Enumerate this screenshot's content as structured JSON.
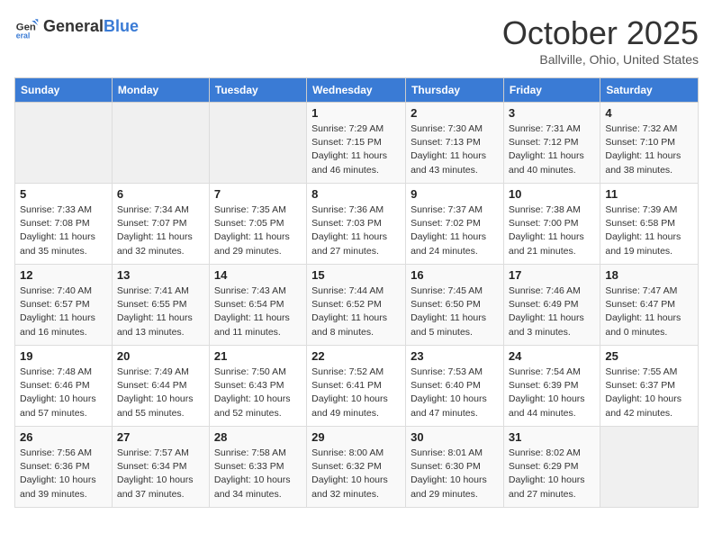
{
  "logo": {
    "general": "General",
    "blue": "Blue"
  },
  "header": {
    "month": "October 2025",
    "location": "Ballville, Ohio, United States"
  },
  "weekdays": [
    "Sunday",
    "Monday",
    "Tuesday",
    "Wednesday",
    "Thursday",
    "Friday",
    "Saturday"
  ],
  "weeks": [
    [
      null,
      null,
      null,
      {
        "day": 1,
        "sunrise": "7:29 AM",
        "sunset": "7:15 PM",
        "daylight": "11 hours and 46 minutes."
      },
      {
        "day": 2,
        "sunrise": "7:30 AM",
        "sunset": "7:13 PM",
        "daylight": "11 hours and 43 minutes."
      },
      {
        "day": 3,
        "sunrise": "7:31 AM",
        "sunset": "7:12 PM",
        "daylight": "11 hours and 40 minutes."
      },
      {
        "day": 4,
        "sunrise": "7:32 AM",
        "sunset": "7:10 PM",
        "daylight": "11 hours and 38 minutes."
      }
    ],
    [
      {
        "day": 5,
        "sunrise": "7:33 AM",
        "sunset": "7:08 PM",
        "daylight": "11 hours and 35 minutes."
      },
      {
        "day": 6,
        "sunrise": "7:34 AM",
        "sunset": "7:07 PM",
        "daylight": "11 hours and 32 minutes."
      },
      {
        "day": 7,
        "sunrise": "7:35 AM",
        "sunset": "7:05 PM",
        "daylight": "11 hours and 29 minutes."
      },
      {
        "day": 8,
        "sunrise": "7:36 AM",
        "sunset": "7:03 PM",
        "daylight": "11 hours and 27 minutes."
      },
      {
        "day": 9,
        "sunrise": "7:37 AM",
        "sunset": "7:02 PM",
        "daylight": "11 hours and 24 minutes."
      },
      {
        "day": 10,
        "sunrise": "7:38 AM",
        "sunset": "7:00 PM",
        "daylight": "11 hours and 21 minutes."
      },
      {
        "day": 11,
        "sunrise": "7:39 AM",
        "sunset": "6:58 PM",
        "daylight": "11 hours and 19 minutes."
      }
    ],
    [
      {
        "day": 12,
        "sunrise": "7:40 AM",
        "sunset": "6:57 PM",
        "daylight": "11 hours and 16 minutes."
      },
      {
        "day": 13,
        "sunrise": "7:41 AM",
        "sunset": "6:55 PM",
        "daylight": "11 hours and 13 minutes."
      },
      {
        "day": 14,
        "sunrise": "7:43 AM",
        "sunset": "6:54 PM",
        "daylight": "11 hours and 11 minutes."
      },
      {
        "day": 15,
        "sunrise": "7:44 AM",
        "sunset": "6:52 PM",
        "daylight": "11 hours and 8 minutes."
      },
      {
        "day": 16,
        "sunrise": "7:45 AM",
        "sunset": "6:50 PM",
        "daylight": "11 hours and 5 minutes."
      },
      {
        "day": 17,
        "sunrise": "7:46 AM",
        "sunset": "6:49 PM",
        "daylight": "11 hours and 3 minutes."
      },
      {
        "day": 18,
        "sunrise": "7:47 AM",
        "sunset": "6:47 PM",
        "daylight": "11 hours and 0 minutes."
      }
    ],
    [
      {
        "day": 19,
        "sunrise": "7:48 AM",
        "sunset": "6:46 PM",
        "daylight": "10 hours and 57 minutes."
      },
      {
        "day": 20,
        "sunrise": "7:49 AM",
        "sunset": "6:44 PM",
        "daylight": "10 hours and 55 minutes."
      },
      {
        "day": 21,
        "sunrise": "7:50 AM",
        "sunset": "6:43 PM",
        "daylight": "10 hours and 52 minutes."
      },
      {
        "day": 22,
        "sunrise": "7:52 AM",
        "sunset": "6:41 PM",
        "daylight": "10 hours and 49 minutes."
      },
      {
        "day": 23,
        "sunrise": "7:53 AM",
        "sunset": "6:40 PM",
        "daylight": "10 hours and 47 minutes."
      },
      {
        "day": 24,
        "sunrise": "7:54 AM",
        "sunset": "6:39 PM",
        "daylight": "10 hours and 44 minutes."
      },
      {
        "day": 25,
        "sunrise": "7:55 AM",
        "sunset": "6:37 PM",
        "daylight": "10 hours and 42 minutes."
      }
    ],
    [
      {
        "day": 26,
        "sunrise": "7:56 AM",
        "sunset": "6:36 PM",
        "daylight": "10 hours and 39 minutes."
      },
      {
        "day": 27,
        "sunrise": "7:57 AM",
        "sunset": "6:34 PM",
        "daylight": "10 hours and 37 minutes."
      },
      {
        "day": 28,
        "sunrise": "7:58 AM",
        "sunset": "6:33 PM",
        "daylight": "10 hours and 34 minutes."
      },
      {
        "day": 29,
        "sunrise": "8:00 AM",
        "sunset": "6:32 PM",
        "daylight": "10 hours and 32 minutes."
      },
      {
        "day": 30,
        "sunrise": "8:01 AM",
        "sunset": "6:30 PM",
        "daylight": "10 hours and 29 minutes."
      },
      {
        "day": 31,
        "sunrise": "8:02 AM",
        "sunset": "6:29 PM",
        "daylight": "10 hours and 27 minutes."
      },
      null
    ]
  ]
}
